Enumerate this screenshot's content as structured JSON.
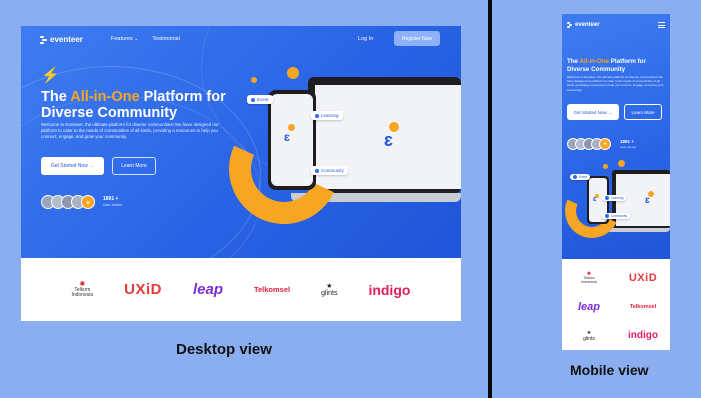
{
  "desktop": {
    "brand": "eventeer",
    "nav": [
      "Features",
      "Testimonial"
    ],
    "login": "Log In",
    "register": "Register Now",
    "hero_title_pre": "The ",
    "hero_title_highlight": "All-in-One",
    "hero_title_post": " Platform for Diverse Community",
    "hero_desc": "Welcome to Eventeer, the ultimate platform for diverse communities! We have designed our platform to cater to the needs of communities of all kinds, providing a resources to help you connect, engage, and grow your community.",
    "cta_primary": "Get Started Now →",
    "cta_secondary": "Learn More",
    "user_count": "1891 +",
    "user_count_label": "User Joined",
    "chips": [
      "Event",
      "Learning",
      "Community"
    ],
    "partners": {
      "telkom_brand": "Telkom",
      "telkom_country": "Indonesia",
      "uxid": "UXiD",
      "leap": "leap",
      "telkomsel": "Telkomsel",
      "glints": "glints",
      "indigo": "indigo"
    },
    "caption": "Desktop view"
  },
  "mobile": {
    "brand": "eventeer",
    "hero_title_pre": "The ",
    "hero_title_highlight": "All-in-One",
    "hero_title_post": " Platform for Diverse Community",
    "hero_desc": "Welcome to Eventeer, the ultimate platform for diverse communities! We have designed our platform to cater to the needs of communities of all kinds, providing a resources to help you connect, engage, and grow your community.",
    "cta_primary": "Get Started Now →",
    "cta_secondary": "Learn More",
    "user_count": "1891 +",
    "user_count_label": "User Joined",
    "chips": [
      "Event",
      "Learning",
      "Community"
    ],
    "caption": "Mobile view"
  },
  "colors": {
    "background": "#8aaef0",
    "hero_blue": "#2a64e6",
    "accent_orange": "#f6a623",
    "divider": "#0a0a0a"
  },
  "icons": [
    "eventeer-logo-icon",
    "hashtag-icon",
    "chevron-down-icon",
    "arrow-right-icon",
    "menu-icon",
    "plus-icon"
  ]
}
